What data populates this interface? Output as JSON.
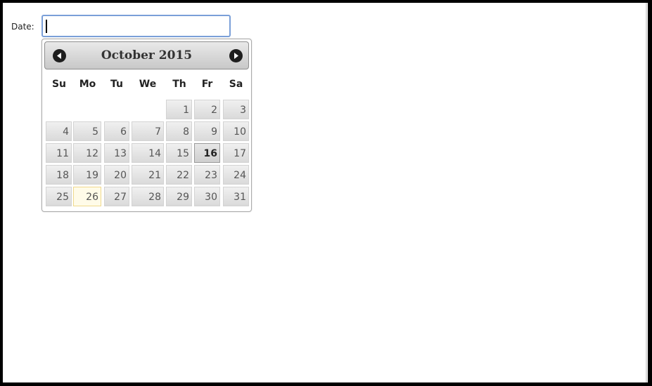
{
  "form": {
    "date_label": "Date:",
    "date_value": ""
  },
  "datepicker": {
    "month_year": "October 2015",
    "prev_icon": "circle-arrow-left-icon",
    "next_icon": "circle-arrow-right-icon",
    "weekdays": [
      "Su",
      "Mo",
      "Tu",
      "We",
      "Th",
      "Fr",
      "Sa"
    ],
    "weeks": [
      [
        null,
        null,
        null,
        null,
        "1",
        "2",
        "3"
      ],
      [
        "4",
        "5",
        "6",
        "7",
        "8",
        "9",
        "10"
      ],
      [
        "11",
        "12",
        "13",
        "14",
        "15",
        "16",
        "17"
      ],
      [
        "18",
        "19",
        "20",
        "21",
        "22",
        "23",
        "24"
      ],
      [
        "25",
        "26",
        "27",
        "28",
        "29",
        "30",
        "31"
      ]
    ],
    "highlighted_today": "26",
    "hovered_day": "16"
  }
}
